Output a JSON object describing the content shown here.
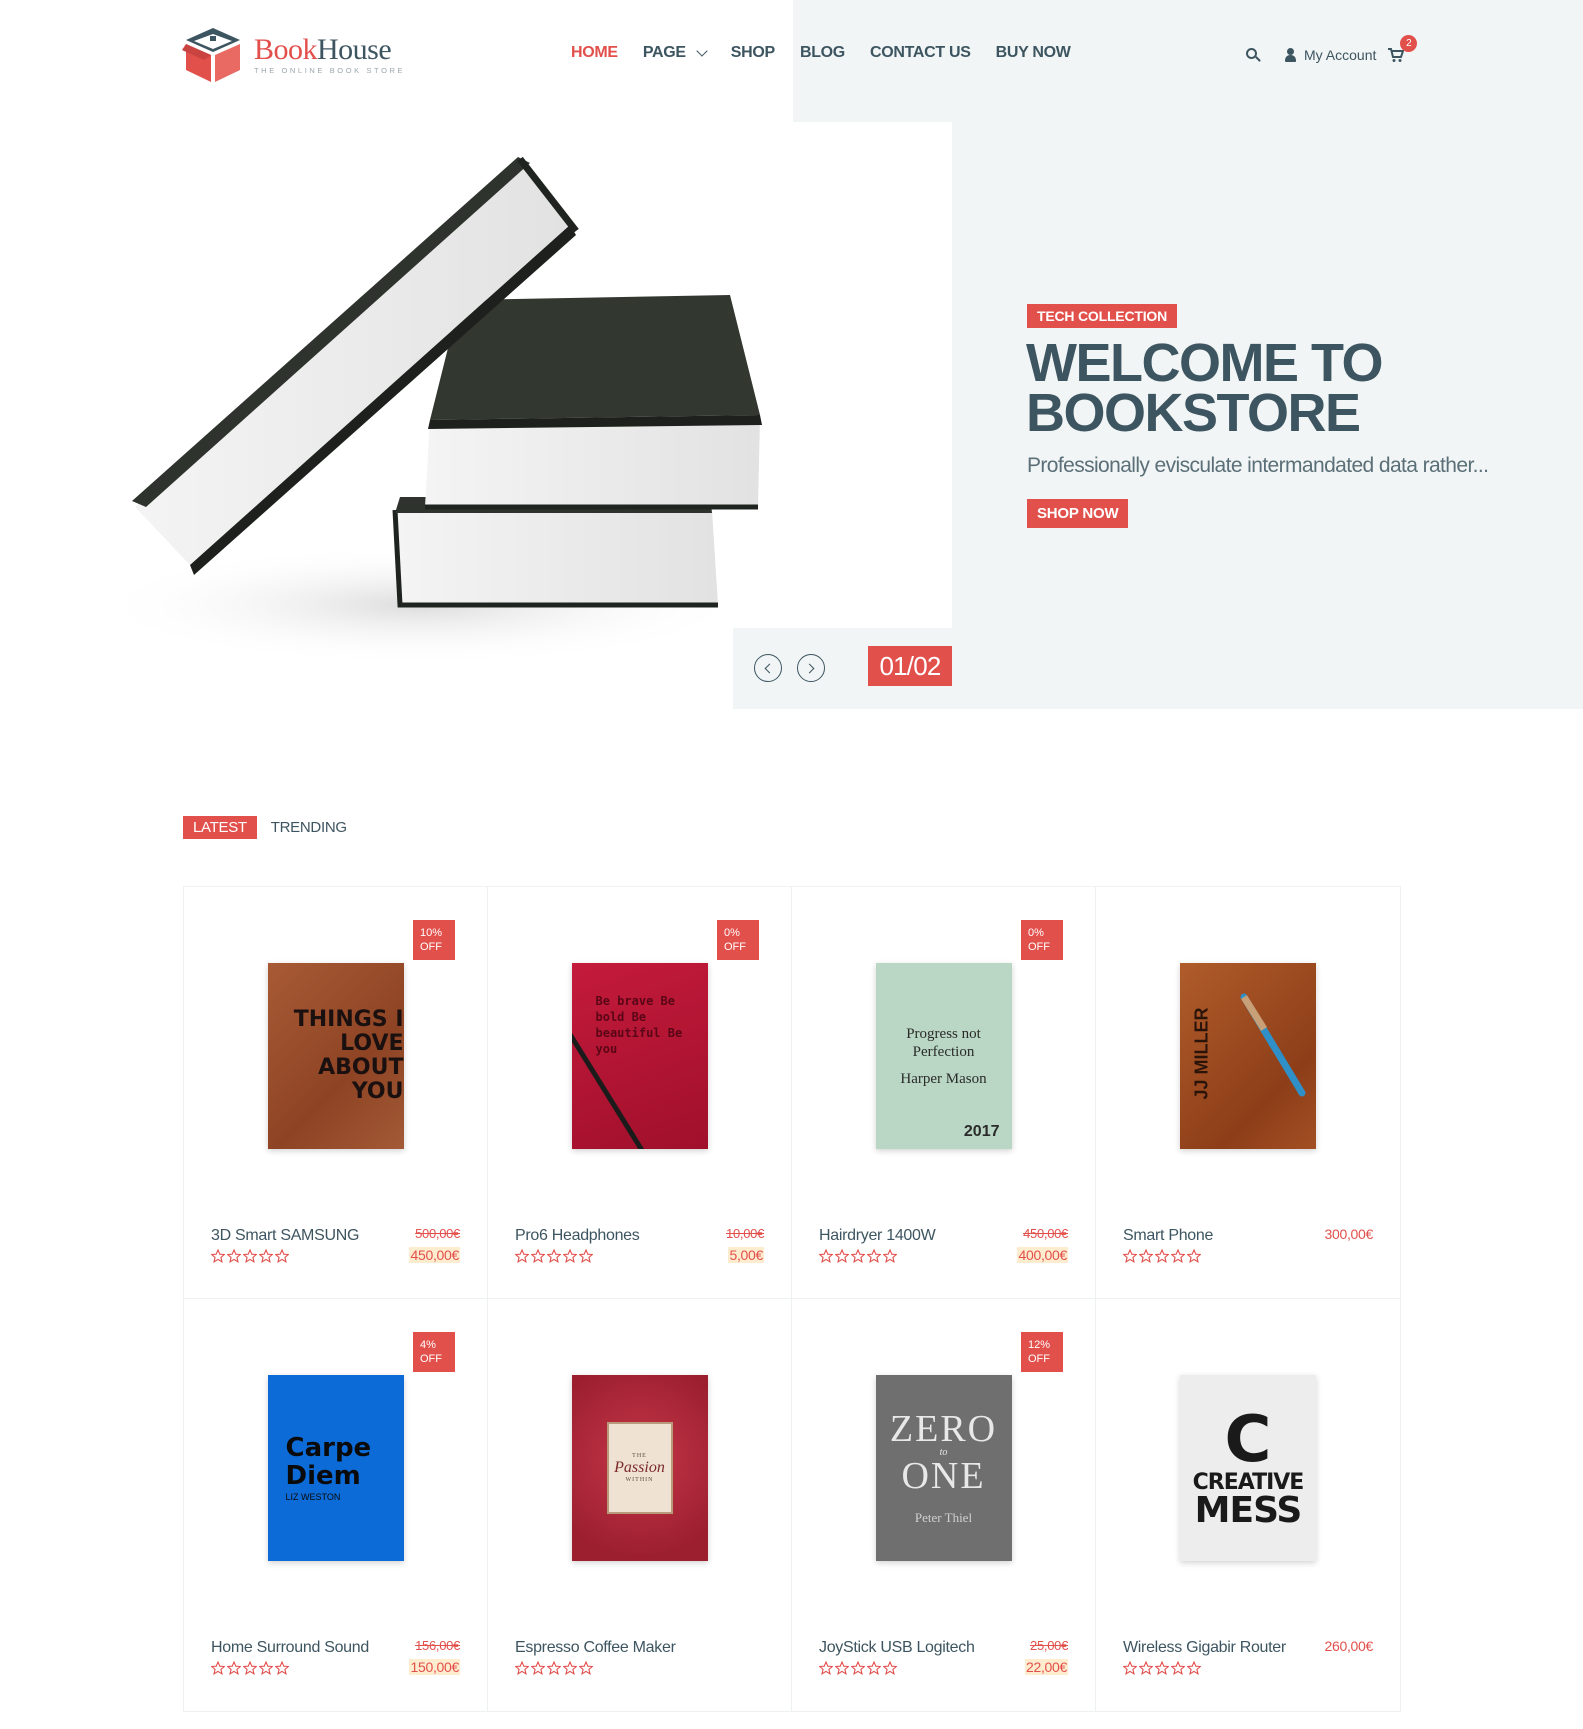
{
  "colors": {
    "accent": "#e2504c",
    "text": "#3d5560",
    "panel": "#f1f5f5",
    "price_highlight": "#fdeccd"
  },
  "brand": {
    "name_part1": "Book",
    "name_part2": "House",
    "tagline": "THE ONLINE BOOK STORE",
    "logo_icon": "box-house-logo"
  },
  "nav": {
    "items": [
      {
        "label": "HOME",
        "active": true
      },
      {
        "label": "PAGE",
        "has_dropdown": true
      },
      {
        "label": "SHOP"
      },
      {
        "label": "BLOG"
      },
      {
        "label": "CONTACT US"
      },
      {
        "label": "BUY NOW"
      }
    ]
  },
  "header_tools": {
    "search_icon": "search-icon",
    "account_label": "My Account",
    "cart_icon": "cart-icon",
    "cart_count": "2"
  },
  "hero": {
    "badge": "TECH COLLECTION",
    "title": "WELCOME TO BOOKSTORE",
    "subtitle": "Professionally evisculate intermandated data rather...",
    "button": "SHOP NOW",
    "slide_counter": "01/02",
    "image": "stacked-books"
  },
  "tabs": [
    {
      "label": "LATEST",
      "active": true
    },
    {
      "label": "TRENDING",
      "active": false
    }
  ],
  "products": [
    {
      "name": "3D Smart SAMSUNG",
      "old_price": "500,00€",
      "price": "450,00€",
      "badge": "10% OFF",
      "rating": 0,
      "cover": {
        "title": "THINGS I LOVE ABOUT YOU"
      }
    },
    {
      "name": "Pro6 Headphones",
      "old_price": "10,00€",
      "price": "5,00€",
      "badge": "0% OFF",
      "rating": 0,
      "cover": {
        "title": "Be brave Be bold Be beautiful Be you"
      }
    },
    {
      "name": "Hairdryer 1400W",
      "old_price": "450,00€",
      "price": "400,00€",
      "badge": "0% OFF",
      "rating": 0,
      "cover": {
        "title": "Progress not Perfection",
        "author": "Harper Mason",
        "year": "2017"
      }
    },
    {
      "name": "Smart Phone",
      "old_price": "",
      "price": "300,00€",
      "badge": "",
      "rating": 0,
      "cover": {
        "title": "JJ MILLER"
      }
    },
    {
      "name": "Home Surround Sound",
      "old_price": "156,00€",
      "price": "150,00€",
      "badge": "4% OFF",
      "rating": 0,
      "cover": {
        "title": "Carpe Diem",
        "author": "LIZ WESTON"
      }
    },
    {
      "name": "Espresso Coffee Maker",
      "old_price": "",
      "price": "",
      "badge": "",
      "rating": 0,
      "cover": {
        "title": "Passion",
        "pre": "THE",
        "post": "WITHIN"
      }
    },
    {
      "name": "JoyStick USB Logitech",
      "old_price": "25,00€",
      "price": "22,00€",
      "badge": "12% OFF",
      "rating": 0,
      "cover": {
        "title": "ZERO",
        "mid": "to",
        "title2": "ONE",
        "author": "Peter Thiel"
      }
    },
    {
      "name": "Wireless Gigabir Router",
      "old_price": "",
      "price": "260,00€",
      "badge": "",
      "rating": 0,
      "cover": {
        "letter": "C",
        "title": "CREATIVE",
        "title2": "MESS"
      }
    }
  ]
}
